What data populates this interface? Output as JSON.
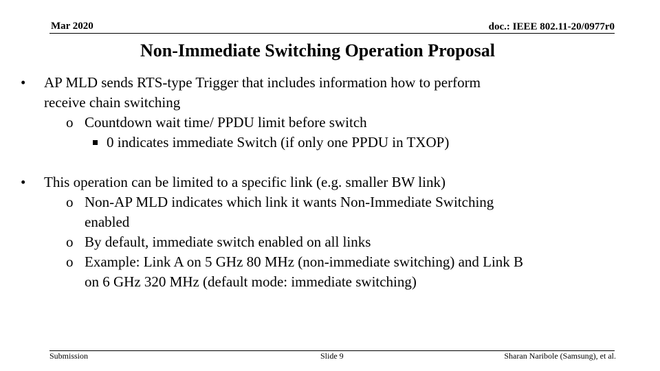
{
  "header": {
    "date": "Mar 2020",
    "doc_id": "doc.: IEEE 802.11-20/0977r0"
  },
  "slide": {
    "title": "Non-Immediate Switching Operation Proposal",
    "bullets": [
      {
        "level": 1,
        "marker": "•",
        "lines": [
          "AP MLD sends RTS-type Trigger that includes information how to perform",
          "receive chain switching"
        ]
      },
      {
        "level": 2,
        "marker": "o",
        "lines": [
          "Countdown wait time/ PPDU limit before switch"
        ]
      },
      {
        "level": 3,
        "marker": "square",
        "lines": [
          "0 indicates immediate Switch (if only one PPDU in TXOP)"
        ]
      },
      {
        "level": 1,
        "marker": "•",
        "lines": [
          "This operation can be limited to a specific link (e.g. smaller BW link)"
        ]
      },
      {
        "level": 2,
        "marker": "o",
        "lines": [
          "Non-AP MLD indicates which link it wants Non-Immediate Switching",
          "enabled"
        ]
      },
      {
        "level": 2,
        "marker": "o",
        "lines": [
          "By default, immediate switch enabled on all links"
        ]
      },
      {
        "level": 2,
        "marker": "o",
        "lines": [
          "Example: Link A on 5 GHz 80 MHz (non-immediate switching) and Link B",
          "on 6 GHz 320 MHz (default mode: immediate switching)"
        ]
      }
    ]
  },
  "footer": {
    "left": "Submission",
    "center": "Slide 9",
    "right": "Sharan Naribole (Samsung), et al."
  }
}
